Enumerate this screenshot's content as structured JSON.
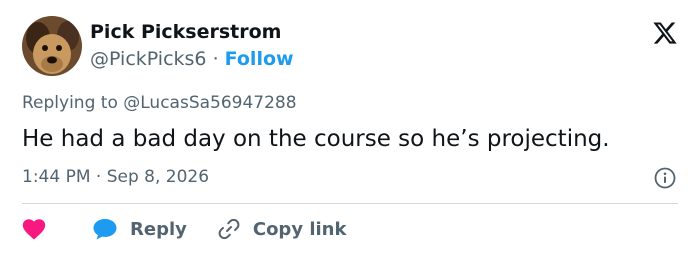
{
  "author": {
    "display_name": "Pick Pickserstrom",
    "handle": "@PickPicks6",
    "separator": "·",
    "follow_label": "Follow"
  },
  "reply_context": {
    "prefix": "Replying to ",
    "handle": "@LucasSa56947288"
  },
  "tweet": {
    "text": "He had a bad day on the course so he’s projecting.",
    "timestamp": "1:44 PM · Sep 8, 2026"
  },
  "actions": {
    "reply_label": "Reply",
    "copy_link_label": "Copy link"
  },
  "icons": {
    "brand": "x-logo-icon",
    "info": "info-icon",
    "like": "heart-icon",
    "reply": "speech-bubble-icon",
    "link": "link-icon"
  },
  "colors": {
    "accent": "#1d9bf0",
    "heart": "#f91880",
    "secondary_text": "#536471",
    "text": "#0f1419",
    "divider": "#cfd9de"
  }
}
